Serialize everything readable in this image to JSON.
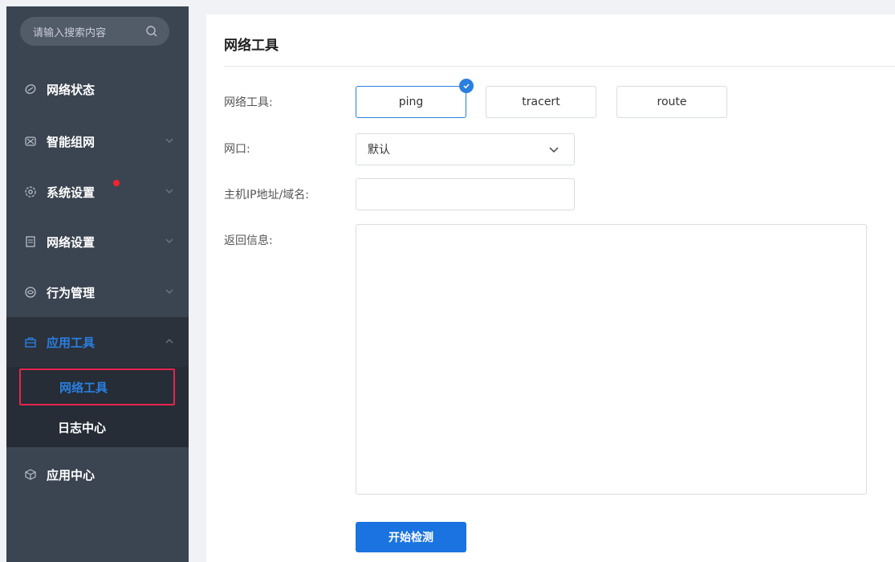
{
  "colors": {
    "sidebar_bg": "#3b4451",
    "accent": "#2a7fe0",
    "highlight_border": "#e8244c",
    "notification_dot": "#f5222d"
  },
  "sidebar": {
    "search": {
      "placeholder": "请输入搜索内容",
      "icon": "search-icon"
    },
    "items": [
      {
        "label": "网络状态",
        "icon": "network-status-icon"
      },
      {
        "label": "智能组网",
        "icon": "smart-network-icon"
      },
      {
        "label": "系统设置",
        "icon": "gear-icon",
        "has_notification": true
      },
      {
        "label": "网络设置",
        "icon": "document-icon"
      },
      {
        "label": "行为管理",
        "icon": "behavior-icon"
      },
      {
        "label": "应用工具",
        "icon": "toolbox-icon",
        "expanded": true
      },
      {
        "label": "应用中心",
        "icon": "cube-icon"
      }
    ],
    "submenu": [
      {
        "label": "网络工具",
        "active": true
      },
      {
        "label": "日志中心",
        "active": false
      }
    ]
  },
  "main": {
    "title": "网络工具",
    "tool_label": "网络工具:",
    "tools": [
      "ping",
      "tracert",
      "route"
    ],
    "selected_tool": "ping",
    "interface_label": "网口:",
    "interface_value": "默认",
    "host_label": "主机IP地址/域名:",
    "host_value": "",
    "result_label": "返回信息:",
    "result_value": "",
    "start_button": "开始检测"
  }
}
